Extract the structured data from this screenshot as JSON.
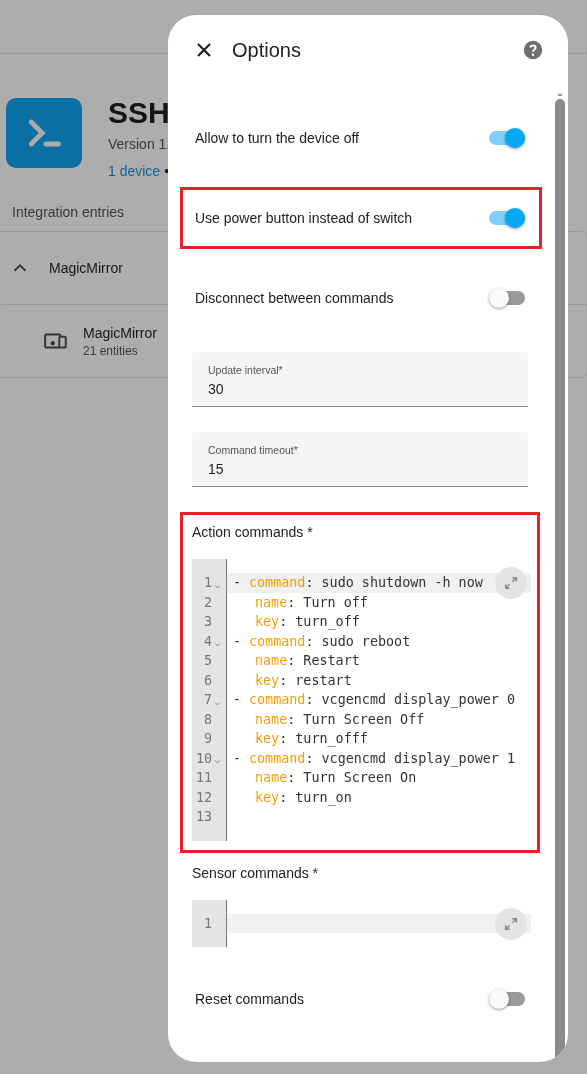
{
  "background_page": {
    "title": "SSH",
    "version": "Version 1.",
    "devices_link": "1 device",
    "separator": "•",
    "section_heading": "Integration entries",
    "entry": {
      "name": "MagicMirror",
      "expanded": true,
      "device": {
        "name": "MagicMirror",
        "entities": "21 entities"
      }
    }
  },
  "dialog": {
    "title": "Options",
    "items": [
      {
        "kind": "toggle",
        "label": "Allow to turn the device off",
        "on": true,
        "highlighted": false
      },
      {
        "kind": "toggle",
        "label": "Use power button instead of switch",
        "on": true,
        "highlighted": true
      },
      {
        "kind": "toggle",
        "label": "Disconnect between commands",
        "on": false,
        "highlighted": false
      },
      {
        "kind": "field",
        "label": "Update interval*",
        "value": "30"
      },
      {
        "kind": "field",
        "label": "Command timeout*",
        "value": "15"
      },
      {
        "kind": "editor",
        "label": "Action commands *",
        "highlighted": true,
        "lines": [
          {
            "number": "1",
            "foldable": true,
            "active": true,
            "dash": "-",
            "key": "command",
            "rest": ": sudo shutdown -h now"
          },
          {
            "number": "2",
            "foldable": false,
            "active": false,
            "key": "name",
            "rest": ": Turn off"
          },
          {
            "number": "3",
            "foldable": false,
            "active": false,
            "key": "key",
            "rest": ": turn_off"
          },
          {
            "number": "4",
            "foldable": true,
            "active": false,
            "dash": "-",
            "key": "command",
            "rest": ": sudo reboot"
          },
          {
            "number": "5",
            "foldable": false,
            "active": false,
            "key": "name",
            "rest": ": Restart"
          },
          {
            "number": "6",
            "foldable": false,
            "active": false,
            "key": "key",
            "rest": ": restart"
          },
          {
            "number": "7",
            "foldable": true,
            "active": false,
            "dash": "-",
            "key": "command",
            "rest": ": vcgencmd display_power 0"
          },
          {
            "number": "8",
            "foldable": false,
            "active": false,
            "key": "name",
            "rest": ": Turn Screen Off"
          },
          {
            "number": "9",
            "foldable": false,
            "active": false,
            "key": "key",
            "rest": ": turn_offf"
          },
          {
            "number": "10",
            "foldable": true,
            "active": false,
            "dash": "-",
            "key": "command",
            "rest": ": vcgencmd display_power 1"
          },
          {
            "number": "11",
            "foldable": false,
            "active": false,
            "key": "name",
            "rest": ": Turn Screen On"
          },
          {
            "number": "12",
            "foldable": false,
            "active": false,
            "key": "key",
            "rest": ": turn_on"
          },
          {
            "number": "13",
            "foldable": false,
            "active": false
          }
        ]
      },
      {
        "kind": "editor",
        "label": "Sensor commands *",
        "highlighted": false,
        "lines": [
          {
            "number": "1",
            "foldable": false,
            "active": true
          }
        ]
      },
      {
        "kind": "toggle",
        "label": "Reset commands",
        "on": false,
        "highlighted": false
      }
    ]
  }
}
